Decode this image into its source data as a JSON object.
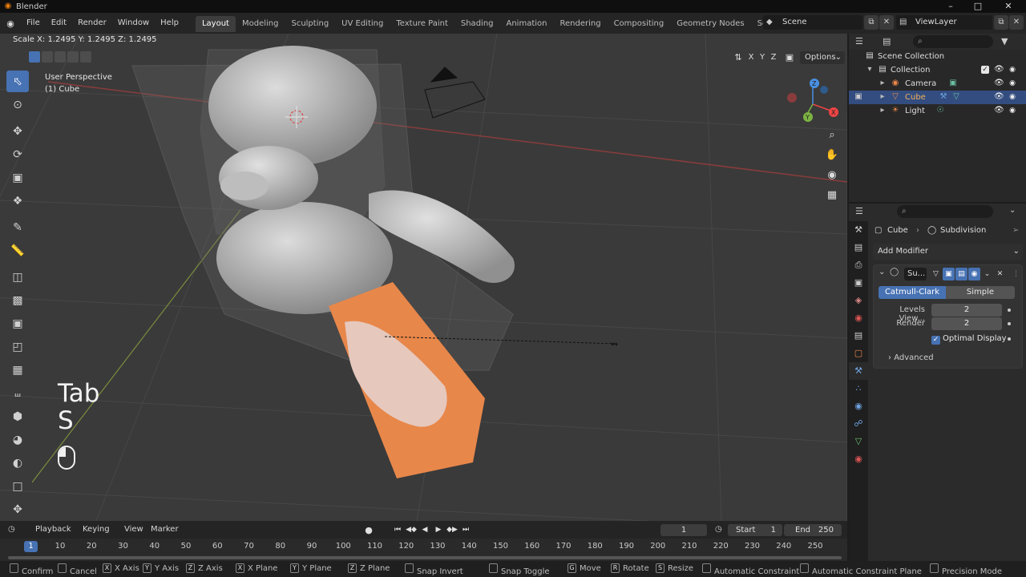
{
  "window": {
    "title": "Blender"
  },
  "menu": [
    "File",
    "Edit",
    "Render",
    "Window",
    "Help"
  ],
  "workspaces": [
    {
      "label": "Layout",
      "active": true
    },
    {
      "label": "Modeling",
      "active": false
    },
    {
      "label": "Sculpting",
      "active": false
    },
    {
      "label": "UV Editing",
      "active": false
    },
    {
      "label": "Texture Paint",
      "active": false
    },
    {
      "label": "Shading",
      "active": false
    },
    {
      "label": "Animation",
      "active": false
    },
    {
      "label": "Rendering",
      "active": false
    },
    {
      "label": "Compositing",
      "active": false
    },
    {
      "label": "Geometry Nodes",
      "active": false
    },
    {
      "label": "Scripting",
      "active": false
    }
  ],
  "add_workspace": "+",
  "scene": {
    "name": "Scene",
    "view_layer": "ViewLayer"
  },
  "viewport": {
    "scale_readout": "Scale X: 1.2495   Y: 1.2495   Z: 1.2495",
    "perspective": "User Perspective",
    "active_object": "(1) Cube",
    "axis_x": "X",
    "axis_y": "Y",
    "axis_z": "Z",
    "options": "Options",
    "gizmo": {
      "x": "X",
      "y": "Y",
      "z": "Z"
    }
  },
  "key_overlay": {
    "line1": "Tab",
    "line2": "S"
  },
  "outliner": {
    "root": "Scene Collection",
    "collection": "Collection",
    "items": [
      "Camera",
      "Cube",
      "Light"
    ],
    "selected": "Cube"
  },
  "properties": {
    "object": "Cube",
    "modifier_crumb": "Subdivision",
    "add_modifier": "Add Modifier",
    "modifier_name": "Su...",
    "catmull": "Catmull-Clark",
    "simple": "Simple",
    "levels_label": "Levels View...",
    "levels_value": "2",
    "render_label": "Render",
    "render_value": "2",
    "optimal": "Optimal Display",
    "advanced": "Advanced"
  },
  "timeline": {
    "playback": "Playback",
    "keying": "Keying",
    "view": "View",
    "marker": "Marker",
    "current": "1",
    "start_label": "Start",
    "start": "1",
    "end_label": "End",
    "end": "250",
    "cursor": "1",
    "ticks": [
      "10",
      "20",
      "30",
      "40",
      "50",
      "60",
      "70",
      "80",
      "90",
      "100",
      "110",
      "120",
      "130",
      "140",
      "150",
      "160",
      "170",
      "180",
      "190",
      "200",
      "210",
      "220",
      "230",
      "240",
      "250"
    ]
  },
  "statusbar": [
    {
      "key": "",
      "label": "Confirm"
    },
    {
      "key": "",
      "label": "Cancel"
    },
    {
      "key": "X",
      "label": "X Axis"
    },
    {
      "key": "Y",
      "label": "Y Axis"
    },
    {
      "key": "Z",
      "label": "Z Axis"
    },
    {
      "key": "X",
      "label": "X Plane"
    },
    {
      "key": "Y",
      "label": "Y Plane"
    },
    {
      "key": "Z",
      "label": "Z Plane"
    },
    {
      "key": "",
      "label": "Snap Invert"
    },
    {
      "key": "",
      "label": "Snap Toggle"
    },
    {
      "key": "G",
      "label": "Move"
    },
    {
      "key": "R",
      "label": "Rotate"
    },
    {
      "key": "S",
      "label": "Resize"
    },
    {
      "key": "",
      "label": "Automatic Constraint"
    },
    {
      "key": "",
      "label": "Automatic Constraint Plane"
    },
    {
      "key": "",
      "label": "Precision Mode"
    }
  ],
  "colors": {
    "accent": "#4772b3",
    "selection_orange": "#e8874a",
    "grid": "#4a4a4a"
  }
}
